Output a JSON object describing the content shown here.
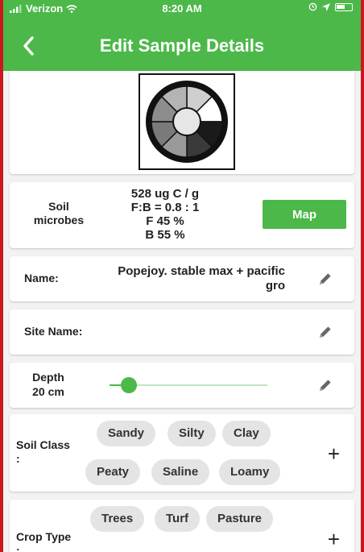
{
  "status_bar": {
    "carrier": "Verizon",
    "time": "8:20 AM"
  },
  "header": {
    "back_icon": "chevron-left-icon",
    "title": "Edit Sample Details"
  },
  "colors": {
    "accent": "#4cb849",
    "frame": "#c8191e"
  },
  "microbes": {
    "label": "Soil microbes",
    "stats": [
      "528 ug C / g",
      "F:B = 0.8 : 1",
      "F 45 %",
      "B 55 %"
    ],
    "map_label": "Map"
  },
  "name": {
    "label": "Name:",
    "value": "Popejoy.  stable max + pacific gro"
  },
  "site_name": {
    "label": "Site Name:",
    "value": ""
  },
  "depth": {
    "label": "Depth",
    "value": "20 cm",
    "slider_fraction": 0.12
  },
  "soil_class": {
    "label": "Soil Class :",
    "options": [
      "Sandy",
      "Silty",
      "Clay",
      "Peaty",
      "Saline",
      "Loamy"
    ]
  },
  "crop_type": {
    "label": "Crop Type :",
    "options": [
      "Trees",
      "Turf",
      "Pasture"
    ]
  }
}
